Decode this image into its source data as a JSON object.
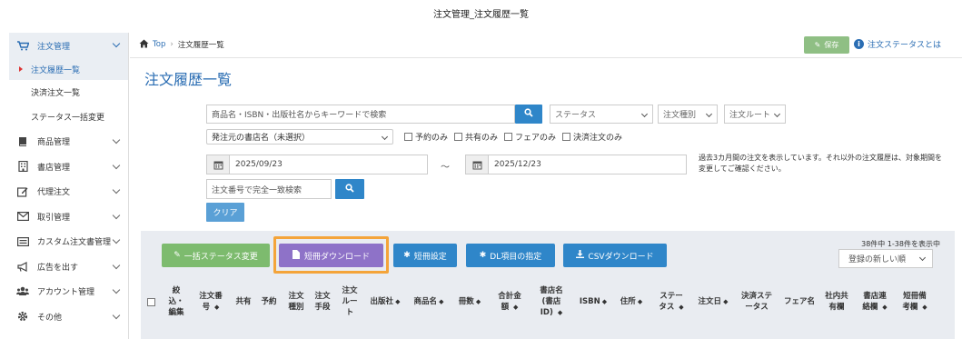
{
  "window_title": "注文管理_注文履歴一覧",
  "sidebar": {
    "sections": [
      {
        "label": "注文管理",
        "icon": "cart-icon",
        "active": true
      },
      {
        "label": "商品管理",
        "icon": "book-icon"
      },
      {
        "label": "書店管理",
        "icon": "building-icon"
      },
      {
        "label": "代理注文",
        "icon": "edit-icon"
      },
      {
        "label": "取引管理",
        "icon": "envelope-icon"
      },
      {
        "label": "カスタム注文書管理",
        "icon": "list-icon"
      },
      {
        "label": "広告を出す",
        "icon": "megaphone-icon"
      },
      {
        "label": "アカウント管理",
        "icon": "users-icon"
      },
      {
        "label": "その他",
        "icon": "gear-icon"
      }
    ],
    "sub_items": [
      "注文履歴一覧",
      "決済注文一覧",
      "ステータス一括変更"
    ]
  },
  "breadcrumb": {
    "home": "Top",
    "current": "注文履歴一覧"
  },
  "header": {
    "save": "保存",
    "status_link": "注文ステータスとは"
  },
  "page_title": "注文履歴一覧",
  "filters": {
    "keyword_placeholder": "商品名・ISBN・出版社名からキーワードで検索",
    "status": "ステータス",
    "order_type": "注文種別",
    "order_route": "注文ルート",
    "store": "発注元の書店名（未選択）",
    "checkboxes": [
      "予約のみ",
      "共有のみ",
      "フェアのみ",
      "決済注文のみ"
    ],
    "date_from": "2025/09/23",
    "date_sep": "〜",
    "date_to": "2025/12/23",
    "note": "過去3カ月間の注文を表示しています。それ以外の注文履歴は、対象期間を変更してご確認ください。",
    "order_no_placeholder": "注文番号で完全一致検索",
    "clear": "クリア"
  },
  "actions": {
    "bulk_status": "一括ステータス変更",
    "tanzaku_dl": "短冊ダウンロード",
    "tanzaku_settings": "短冊設定",
    "dl_items": "DL項目の指定",
    "csv_dl": "CSVダウンロード",
    "count": "38件中 1-38件を表示中",
    "sort": "登録の新しい順"
  },
  "table_headers": [
    "絞込・編集",
    "注文番号",
    "共有",
    "予約",
    "注文種別",
    "注文手段",
    "注文ルート",
    "出版社",
    "商品名",
    "冊数",
    "合計金額",
    "書店名(書店ID)",
    "ISBN",
    "住所",
    "ステータス",
    "注文日",
    "決済ステータス",
    "フェア名",
    "社内共有欄",
    "書店連絡欄",
    "短冊備考欄"
  ],
  "colors": {
    "accent": "#2a6db3",
    "green": "#7dbb6e",
    "purple": "#8e72c8",
    "blue": "#2f86c9",
    "highlight": "#f4a43a"
  }
}
